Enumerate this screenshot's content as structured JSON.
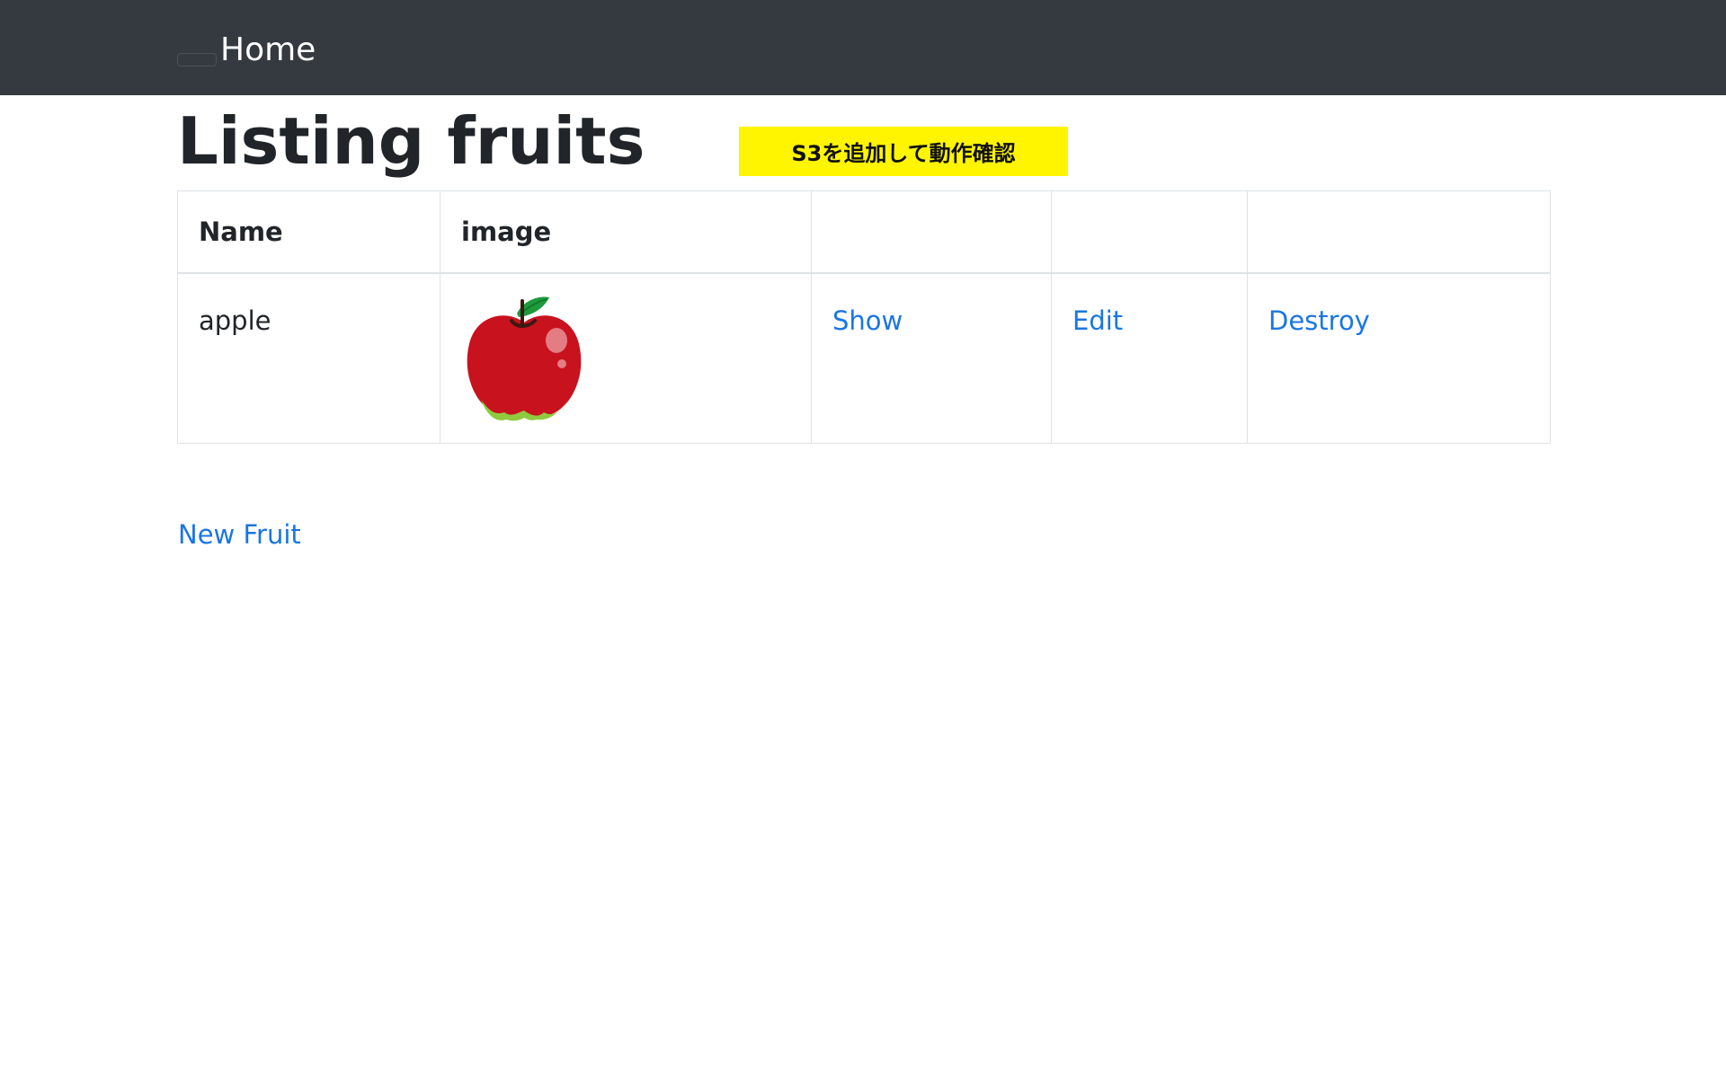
{
  "navbar": {
    "home_label": "Home",
    "background": "#343a40"
  },
  "page": {
    "title": "Listing fruits",
    "note_banner": "S3を追加して動作確認",
    "note_banner_color": "#fff500"
  },
  "table": {
    "headers": [
      "Name",
      "image",
      "",
      "",
      ""
    ],
    "rows": [
      {
        "name": "apple",
        "image_icon": "apple-icon",
        "show_label": "Show",
        "edit_label": "Edit",
        "destroy_label": "Destroy"
      }
    ]
  },
  "actions": {
    "new_label": "New Fruit"
  },
  "colors": {
    "link": "#1a76e3",
    "border": "#dee2e6"
  }
}
